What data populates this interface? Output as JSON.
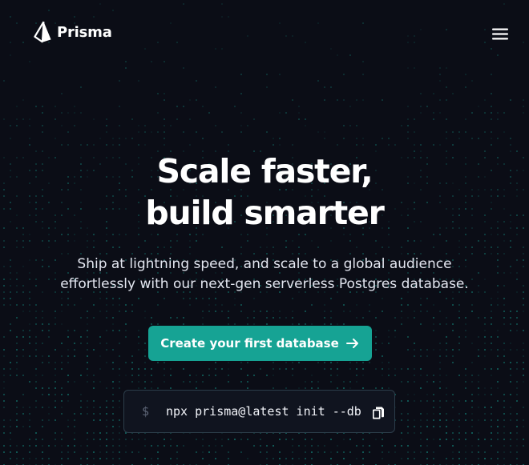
{
  "header": {
    "brand_name": "Prisma",
    "logo_icon": "prisma-logo-icon",
    "menu_icon": "hamburger-menu-icon"
  },
  "hero": {
    "headline_line1": "Scale faster,",
    "headline_line2": "build smarter",
    "subtext_line1": "Ship at lightning speed, and scale to a global audience",
    "subtext_line2": "effortlessly with our next-gen serverless Postgres database."
  },
  "cta": {
    "label": "Create your first database",
    "icon": "arrow-right-icon"
  },
  "command": {
    "prompt": "$",
    "text": "npx prisma@latest init --db",
    "copy_icon": "copy-icon"
  },
  "colors": {
    "background": "#0b0d16",
    "accent": "#16a394",
    "dots": "#16a394",
    "text": "#ffffff"
  }
}
